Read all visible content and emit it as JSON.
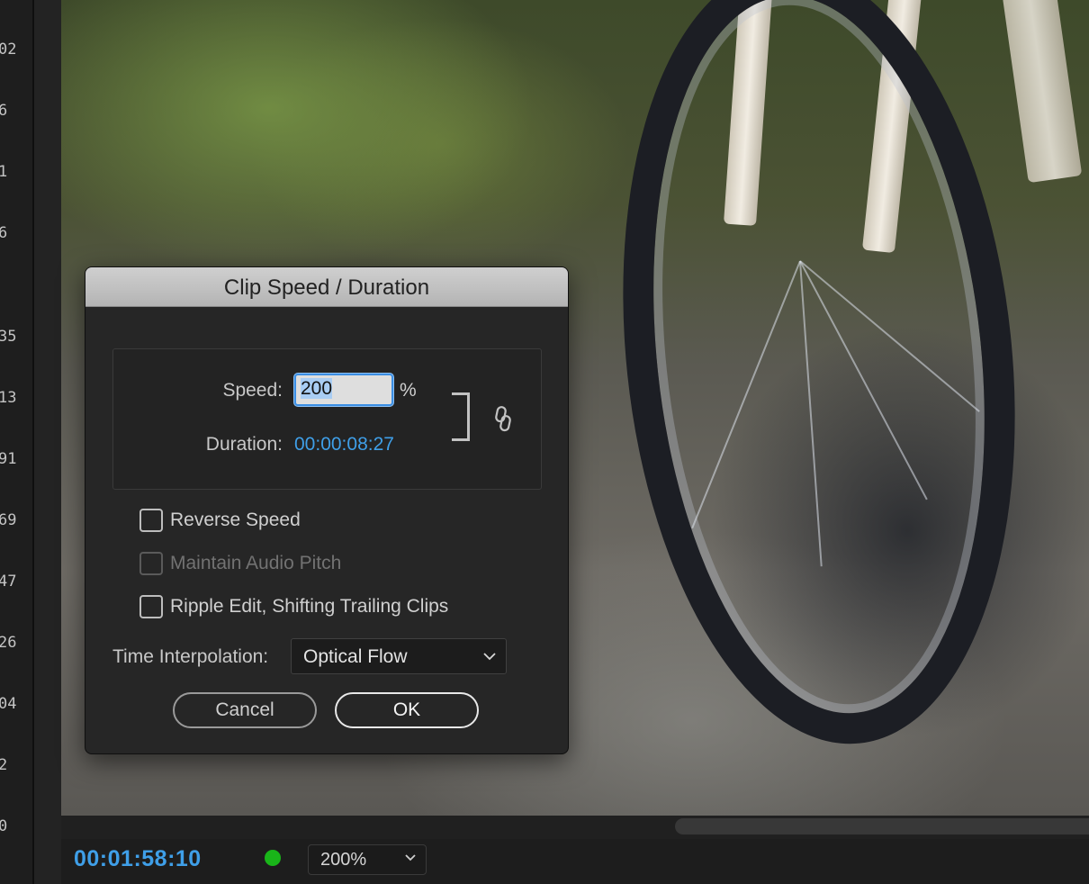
{
  "ruler": {
    "labels": [
      "02",
      "6",
      "1",
      "6",
      "35",
      "13",
      "91",
      "69",
      "47",
      "26",
      "04",
      "2",
      "0"
    ]
  },
  "dialog": {
    "title": "Clip Speed / Duration",
    "speed_label": "Speed:",
    "speed_value": "200",
    "percent_symbol": "%",
    "duration_label": "Duration:",
    "duration_value": "00:00:08:27",
    "link_icon": "chain-link-icon",
    "checkboxes": [
      {
        "label": "Reverse Speed",
        "checked": false,
        "enabled": true
      },
      {
        "label": "Maintain Audio Pitch",
        "checked": false,
        "enabled": false
      },
      {
        "label": "Ripple Edit, Shifting Trailing Clips",
        "checked": false,
        "enabled": true
      }
    ],
    "interpolation_label": "Time Interpolation:",
    "interpolation_value": "Optical Flow",
    "cancel_label": "Cancel",
    "ok_label": "OK"
  },
  "monitor": {
    "timecode": "00:01:58:10",
    "status_color": "#19b519",
    "zoom_value": "200%"
  },
  "colors": {
    "accent_blue": "#3f9fe8",
    "dialog_bg": "#262626",
    "title_bar": "#c4c4c4"
  }
}
